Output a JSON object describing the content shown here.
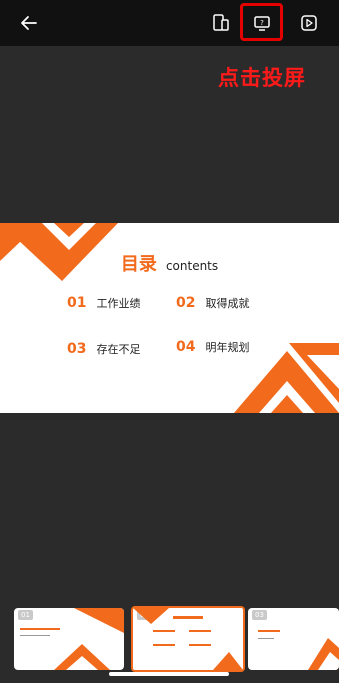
{
  "topbar": {
    "back_icon": "arrow-left-icon",
    "mirror_icon": "phone-mirror-icon",
    "cast_icon": "screen-cast-icon",
    "play_icon": "play-icon"
  },
  "annotation": {
    "text": "点击投屏",
    "color": "#ff1a1a"
  },
  "slide": {
    "title_cn": "目录",
    "title_en": "contents",
    "items": [
      {
        "num": "01",
        "text": "工作业绩"
      },
      {
        "num": "02",
        "text": "取得成就"
      },
      {
        "num": "03",
        "text": "存在不足"
      },
      {
        "num": "04",
        "text": "明年规划"
      }
    ],
    "accent": "#f26a1b"
  },
  "thumbnails": [
    {
      "num": "01",
      "active": false
    },
    {
      "num": "02",
      "active": true
    },
    {
      "num": "03",
      "active": false
    }
  ]
}
